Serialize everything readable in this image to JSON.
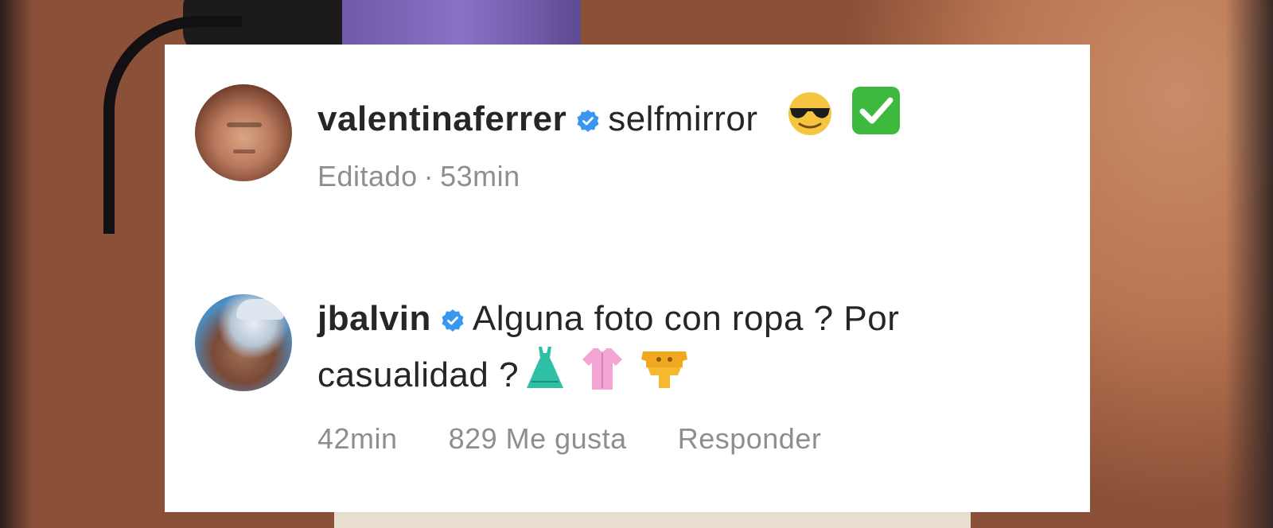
{
  "comments": [
    {
      "username": "valentinaferrer",
      "verified": true,
      "text": "selfmirror",
      "emojis": [
        "sunglasses-emoji",
        "check-mark-button-emoji"
      ],
      "meta": {
        "edited_label": "Editado",
        "separator": "·",
        "time": "53min"
      }
    },
    {
      "username": "jbalvin",
      "verified": true,
      "text_line_1": "Alguna foto con ropa ? Por",
      "text_line_2": "casualidad ?",
      "emojis": [
        "dress-emoji",
        "blouse-emoji",
        "clothing-emoji"
      ],
      "meta": {
        "time": "42min",
        "likes": "829 Me gusta",
        "reply": "Responder"
      }
    }
  ],
  "colors": {
    "verified_blue": "#3897f0",
    "text": "#262626",
    "meta": "#8e8e8e",
    "card_bg": "#ffffff"
  }
}
